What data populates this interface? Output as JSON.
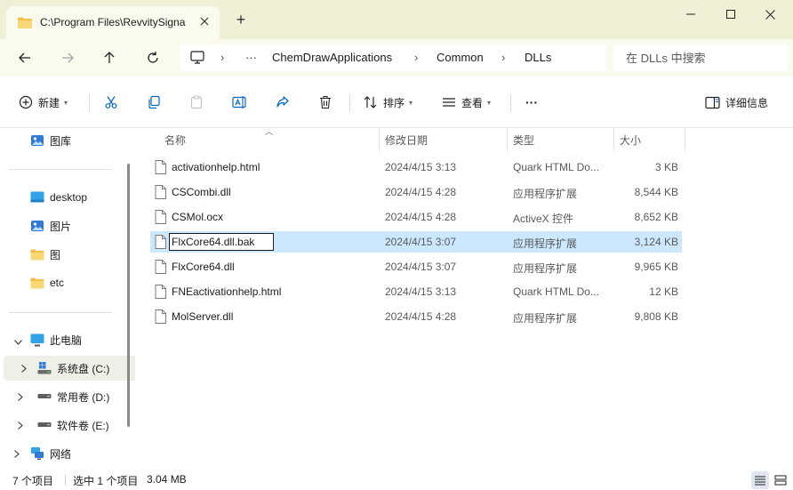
{
  "window": {
    "tab_title": "C:\\Program Files\\RevvitySigna",
    "new_tab": "+"
  },
  "address": {
    "ellipsis": "···",
    "crumbs": [
      "ChemDrawApplications",
      "Common",
      "DLLs"
    ],
    "search_placeholder": "在 DLLs 中搜索"
  },
  "commands": {
    "new_label": "新建",
    "sort_label": "排序",
    "view_label": "查看",
    "more": "···",
    "details_label": "详细信息"
  },
  "navpane": {
    "gallery": "图库",
    "quick": [
      {
        "label": "desktop",
        "icon": "desktop-folder-icon"
      },
      {
        "label": "图片",
        "icon": "pictures-icon"
      },
      {
        "label": "图",
        "icon": "folder-icon"
      },
      {
        "label": "etc",
        "icon": "folder-icon"
      }
    ],
    "this_pc": "此电脑",
    "drives": [
      {
        "label": "系统盘 (C:)",
        "icon": "system-drive-icon"
      },
      {
        "label": "常用卷 (D:)",
        "icon": "drive-icon"
      },
      {
        "label": "软件卷 (E:)",
        "icon": "drive-icon"
      }
    ],
    "network": "网络"
  },
  "columns": {
    "name": "名称",
    "date": "修改日期",
    "type": "类型",
    "size": "大小"
  },
  "files": [
    {
      "name": "activationhelp.html",
      "date": "2024/4/15 3:13",
      "type": "Quark HTML Do...",
      "size": "3 KB",
      "selected": false
    },
    {
      "name": "CSCombi.dll",
      "date": "2024/4/15 4:28",
      "type": "应用程序扩展",
      "size": "8,544 KB",
      "selected": false
    },
    {
      "name": "CSMol.ocx",
      "date": "2024/4/15 4:28",
      "type": "ActiveX 控件",
      "size": "8,652 KB",
      "selected": false
    },
    {
      "name": "FlxCore64.dll.bak",
      "date": "2024/4/15 3:07",
      "type": "应用程序扩展",
      "size": "3,124 KB",
      "selected": true
    },
    {
      "name": "FlxCore64.dll",
      "date": "2024/4/15 3:07",
      "type": "应用程序扩展",
      "size": "9,965 KB",
      "selected": false
    },
    {
      "name": "FNEactivationhelp.html",
      "date": "2024/4/15 3:13",
      "type": "Quark HTML Do...",
      "size": "12 KB",
      "selected": false
    },
    {
      "name": "MolServer.dll",
      "date": "2024/4/15 4:28",
      "type": "应用程序扩展",
      "size": "9,808 KB",
      "selected": false
    }
  ],
  "status": {
    "count": "7 个项目",
    "selected": "选中 1 个项目",
    "selected_size": "3.04 MB"
  },
  "colors": {
    "titlebar_bg": "#eef1d6",
    "toolbar_bg": "#f9fbef",
    "selection": "#cce8ff",
    "accent": "#0067c0",
    "folder": "#f2c04a"
  }
}
